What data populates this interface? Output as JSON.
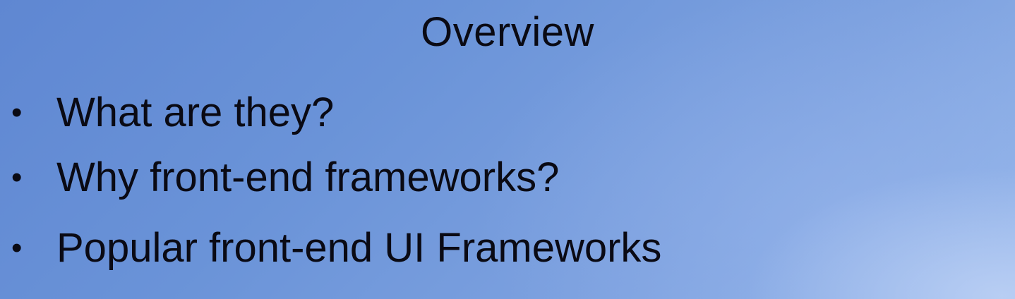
{
  "slide": {
    "title": "Overview",
    "bullets": [
      {
        "marker": "•",
        "text": "What are they?"
      },
      {
        "marker": "•",
        "text": "Why front-end frameworks?"
      },
      {
        "marker": "•",
        "text": "Popular front-end UI Frameworks"
      }
    ]
  },
  "colors": {
    "background_top_left": "#5f87d2",
    "background_bottom_right": "#95b6ea",
    "text": "#0a0a14"
  }
}
